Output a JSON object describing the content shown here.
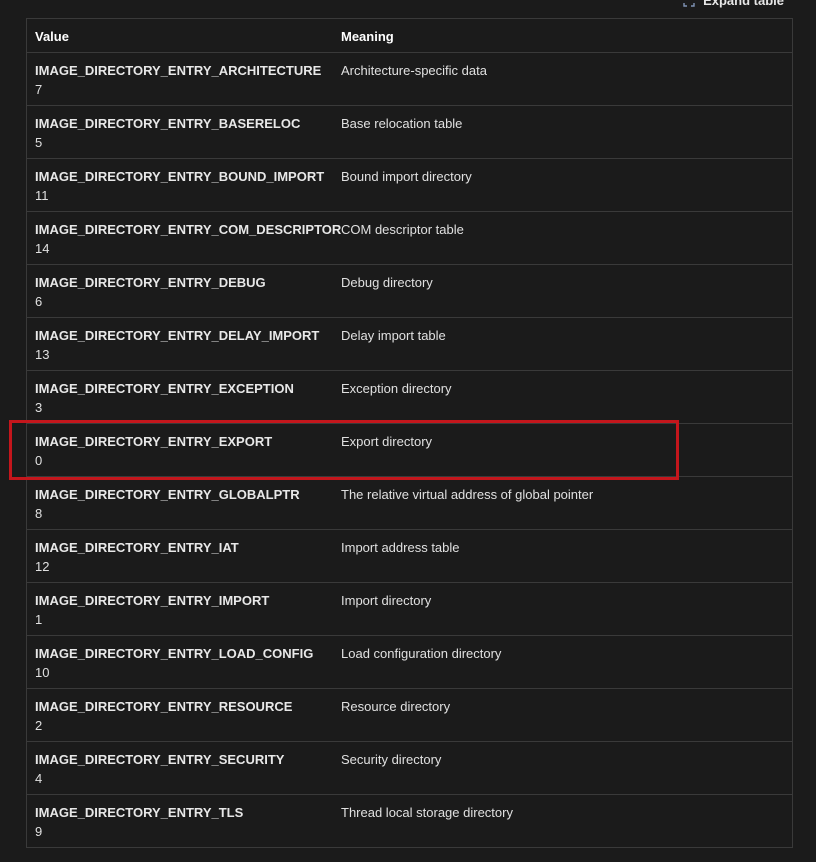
{
  "toolbar": {
    "expand_label": "Expand table",
    "expand_icon": "expand-icon"
  },
  "table": {
    "headers": [
      "Value",
      "Meaning"
    ],
    "rows": [
      {
        "name": "IMAGE_DIRECTORY_ENTRY_ARCHITECTURE",
        "value": "7",
        "meaning": "Architecture-specific data"
      },
      {
        "name": "IMAGE_DIRECTORY_ENTRY_BASERELOC",
        "value": "5",
        "meaning": "Base relocation table"
      },
      {
        "name": "IMAGE_DIRECTORY_ENTRY_BOUND_IMPORT",
        "value": "11",
        "meaning": "Bound import directory"
      },
      {
        "name": "IMAGE_DIRECTORY_ENTRY_COM_DESCRIPTOR",
        "value": "14",
        "meaning": "COM descriptor table"
      },
      {
        "name": "IMAGE_DIRECTORY_ENTRY_DEBUG",
        "value": "6",
        "meaning": "Debug directory"
      },
      {
        "name": "IMAGE_DIRECTORY_ENTRY_DELAY_IMPORT",
        "value": "13",
        "meaning": "Delay import table"
      },
      {
        "name": "IMAGE_DIRECTORY_ENTRY_EXCEPTION",
        "value": "3",
        "meaning": "Exception directory"
      },
      {
        "name": "IMAGE_DIRECTORY_ENTRY_EXPORT",
        "value": "0",
        "meaning": "Export directory"
      },
      {
        "name": "IMAGE_DIRECTORY_ENTRY_GLOBALPTR",
        "value": "8",
        "meaning": "The relative virtual address of global pointer"
      },
      {
        "name": "IMAGE_DIRECTORY_ENTRY_IAT",
        "value": "12",
        "meaning": "Import address table"
      },
      {
        "name": "IMAGE_DIRECTORY_ENTRY_IMPORT",
        "value": "1",
        "meaning": "Import directory"
      },
      {
        "name": "IMAGE_DIRECTORY_ENTRY_LOAD_CONFIG",
        "value": "10",
        "meaning": "Load configuration directory"
      },
      {
        "name": "IMAGE_DIRECTORY_ENTRY_RESOURCE",
        "value": "2",
        "meaning": "Resource directory"
      },
      {
        "name": "IMAGE_DIRECTORY_ENTRY_SECURITY",
        "value": "4",
        "meaning": "Security directory"
      },
      {
        "name": "IMAGE_DIRECTORY_ENTRY_TLS",
        "value": "9",
        "meaning": "Thread local storage directory"
      }
    ]
  },
  "highlight": {
    "row_name": "IMAGE_DIRECTORY_ENTRY_EXPORT",
    "color": "#c4161c"
  },
  "colors": {
    "background": "#1b1b1b",
    "border": "#3a3a3a",
    "text": "#e6e6e6"
  }
}
